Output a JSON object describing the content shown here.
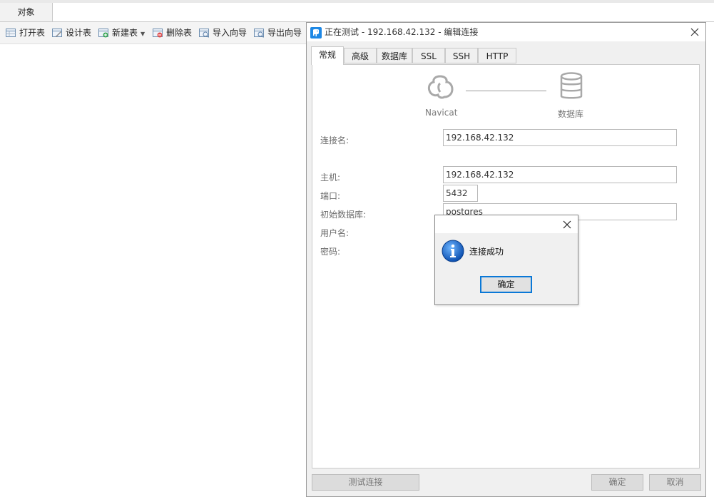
{
  "main": {
    "object_tab": "对象",
    "toolbar": [
      {
        "label": "打开表",
        "icon": "open-table-icon"
      },
      {
        "label": "设计表",
        "icon": "design-table-icon"
      },
      {
        "label": "新建表",
        "icon": "new-table-icon",
        "dropdown": true
      },
      {
        "label": "删除表",
        "icon": "delete-table-icon"
      },
      {
        "label": "导入向导",
        "icon": "import-wizard-icon"
      },
      {
        "label": "导出向导",
        "icon": "export-wizard-icon"
      }
    ]
  },
  "dialog": {
    "title": "正在测试 - 192.168.42.132 - 编辑连接",
    "tabs": [
      "常规",
      "高级",
      "数据库",
      "SSL",
      "SSH",
      "HTTP"
    ],
    "active_tab": "常规",
    "logo_left_label": "Navicat",
    "logo_right_label": "数据库",
    "fields": {
      "connection_name": {
        "label": "连接名:",
        "value": "192.168.42.132"
      },
      "host": {
        "label": "主机:",
        "value": "192.168.42.132"
      },
      "port": {
        "label": "端口:",
        "value": "5432"
      },
      "initial_db": {
        "label": "初始数据库:",
        "value": "postgres"
      },
      "username": {
        "label": "用户名:"
      },
      "password": {
        "label": "密码:"
      }
    },
    "buttons": {
      "test": "测试连接",
      "ok": "确定",
      "cancel": "取消"
    }
  },
  "message_box": {
    "text": "连接成功",
    "ok_label": "确定"
  },
  "colors": {
    "accent": "#0a78d7",
    "navicat_blue": "#1e88e5"
  }
}
